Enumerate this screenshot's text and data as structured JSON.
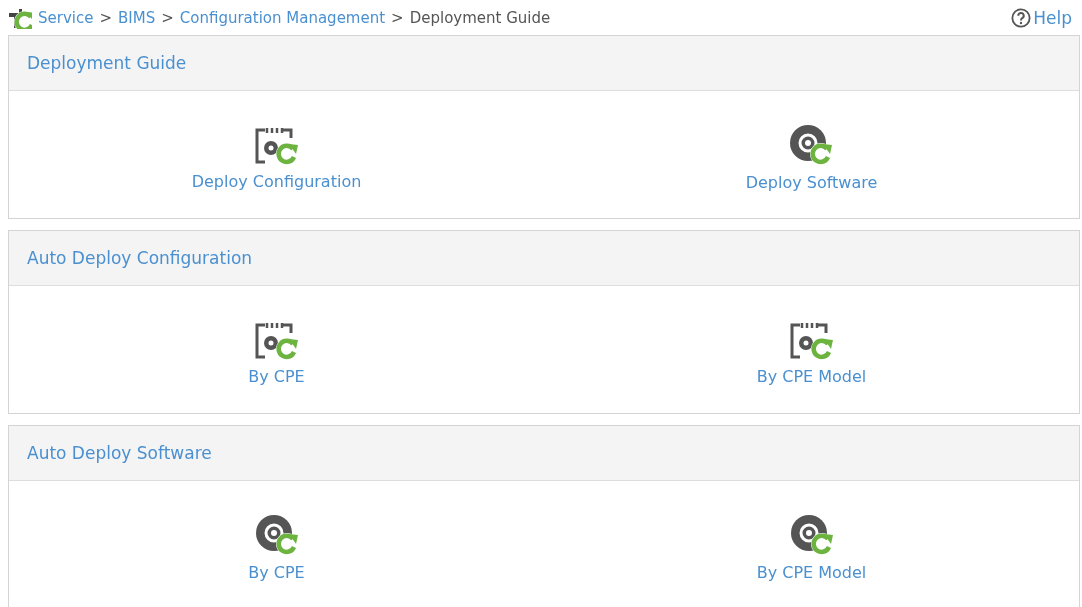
{
  "breadcrumb": [
    {
      "label": "Service",
      "current": false
    },
    {
      "label": "BIMS",
      "current": false
    },
    {
      "label": "Configuration Management",
      "current": false
    },
    {
      "label": "Deployment Guide",
      "current": true
    }
  ],
  "separator": ">",
  "help": {
    "label": "Help"
  },
  "panels": [
    {
      "title": "Deployment Guide",
      "items": [
        {
          "label": "Deploy Configuration",
          "kind": "config"
        },
        {
          "label": "Deploy Software",
          "kind": "software"
        }
      ]
    },
    {
      "title": "Auto Deploy Configuration",
      "items": [
        {
          "label": "By CPE",
          "kind": "config"
        },
        {
          "label": "By CPE Model",
          "kind": "config"
        }
      ]
    },
    {
      "title": "Auto Deploy Software",
      "items": [
        {
          "label": "By CPE",
          "kind": "software"
        },
        {
          "label": "By CPE Model",
          "kind": "software"
        }
      ]
    }
  ]
}
